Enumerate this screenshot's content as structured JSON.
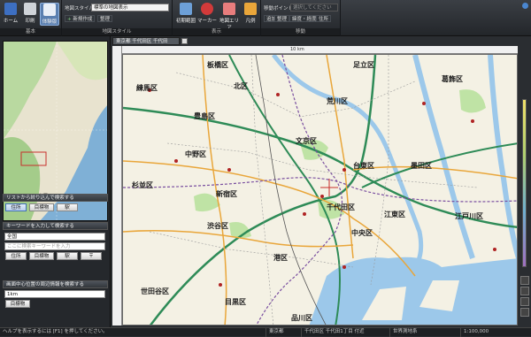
{
  "ribbon": {
    "home": "ホーム",
    "print": "印刷",
    "layer": "体験版",
    "map_style_label": "地図スタイル",
    "map_style_value": "標準の地図表示",
    "new_create": "新規作成",
    "organize": "整理",
    "group_basic": "基本",
    "group_map_style": "地図スタイル",
    "initial_view": "初期範囲",
    "marker": "マーカー",
    "map_area": "地図エリア",
    "legend": "凡例",
    "group_display": "表示",
    "move_point_label": "移動ポイント",
    "move_point_value": "選択してください",
    "add": "追加",
    "organize2": "整理",
    "latlon": "緯度・経度",
    "address_search": "住所",
    "group_move": "移動"
  },
  "left": {
    "search_list_head": "リストから絞り込んで検索する",
    "tab_address": "住所",
    "tab_landmark": "目標物",
    "tab_station": "駅",
    "keyword_head": "キーワードを入力して検索する",
    "pref_value": "全国",
    "keyword_placeholder": "ここに検索キーワードを入力",
    "kw_tab_address": "住所",
    "kw_tab_landmark": "目標物",
    "kw_tab_station": "駅",
    "kw_tab_other": "〒",
    "nearby_head": "画面中心位置の周辺情報を検索する",
    "radius_value": "1km",
    "nearby_landmark": "目標物"
  },
  "map": {
    "tab_title": "東京都 千代田区 千代田",
    "scale_top": "10 km",
    "wards": [
      {
        "name": "北区"
      },
      {
        "name": "板橋区"
      },
      {
        "name": "足立区"
      },
      {
        "name": "葛飾区"
      },
      {
        "name": "練馬区"
      },
      {
        "name": "荒川区"
      },
      {
        "name": "豊島区"
      },
      {
        "name": "中野区"
      },
      {
        "name": "文京区"
      },
      {
        "name": "台東区"
      },
      {
        "name": "墨田区"
      },
      {
        "name": "杉並区"
      },
      {
        "name": "新宿区"
      },
      {
        "name": "千代田区"
      },
      {
        "name": "江東区"
      },
      {
        "name": "江戸川区"
      },
      {
        "name": "渋谷区"
      },
      {
        "name": "中央区"
      },
      {
        "name": "世田谷区"
      },
      {
        "name": "目黒区"
      },
      {
        "name": "港区"
      },
      {
        "name": "品川区"
      }
    ]
  },
  "status": {
    "help": "ヘルプを表示するには [F1] を押してください。",
    "pref": "東京都",
    "address": "千代田区 千代田1丁目 付近",
    "datum": "世界測地系",
    "scale": "1:100,000"
  },
  "colors": {
    "water": "#9cc8ea",
    "park": "#bfe3a5",
    "expressway": "#2e8b57",
    "rail": "#7a4fa0",
    "ribbon_active": "#5a7fb0"
  }
}
